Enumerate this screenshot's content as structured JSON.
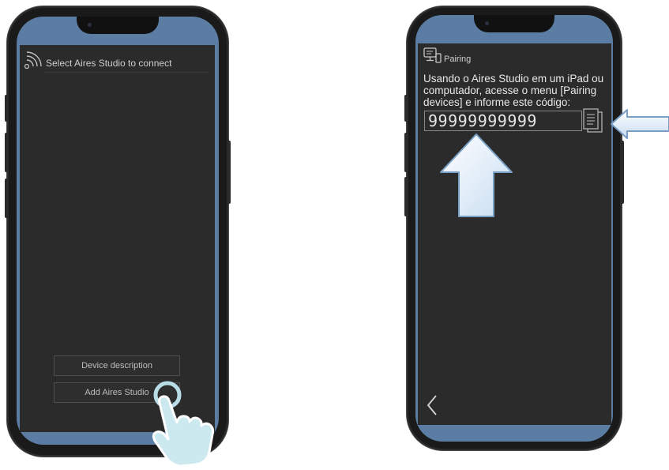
{
  "left_phone": {
    "header": {
      "title": "Select Aires Studio to connect",
      "icon": "wireless-signal-icon"
    },
    "buttons": {
      "device_description": "Device description",
      "add_aires_studio": "Add Aires Studio"
    },
    "hand_icon": "tap-hand-icon"
  },
  "right_phone": {
    "header": {
      "title": "Pairing",
      "icon": "pairing-devices-icon"
    },
    "instructions": "Usando o Aires Studio em um iPad ou computador, acesse o menu [Pairing devices] e informe este código:",
    "code": "99999999999",
    "copy_icon": "copy-document-icon",
    "back_icon": "chevron-left-icon",
    "arrow_up_icon": "arrow-up-icon",
    "arrow_left_icon": "arrow-left-icon"
  },
  "colors": {
    "frame": "#5b7da3",
    "screen": "#2b2b2b",
    "arrow": "#d6e6f7"
  }
}
